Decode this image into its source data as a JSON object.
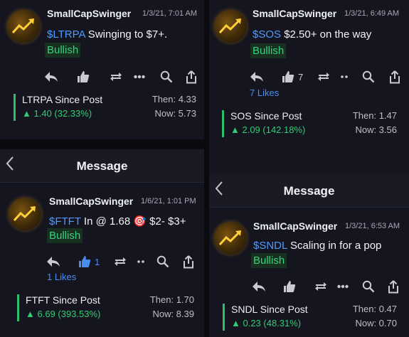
{
  "message_header": {
    "title": "Message",
    "back_icon": "chevron-left-icon"
  },
  "colors": {
    "cashtag": "#4d9bff",
    "bullish": "#37d27e",
    "gain": "#2fce74",
    "link": "#4a8df0"
  },
  "posts": [
    {
      "username": "SmallCapSwinger",
      "timestamp": "1/3/21, 7:01 AM",
      "cashtag": "$LTRPA",
      "text": " Swinging to $7+.",
      "sentiment": "Bullish",
      "like_count": "",
      "likes_label": "",
      "card": {
        "title": "LTRPA Since Post",
        "gain": "▲ 1.40 (32.33%)",
        "then": "Then: 4.33",
        "now": "Now: 5.73"
      }
    },
    {
      "username": "SmallCapSwinger",
      "timestamp": "1/3/21, 6:49 AM",
      "cashtag": "$SOS",
      "text": " $2.50+ on the way",
      "sentiment": "Bullish",
      "like_count": "7",
      "likes_label": "7 Likes",
      "card": {
        "title": "SOS Since Post",
        "gain": "▲ 2.09 (142.18%)",
        "then": "Then: 1.47",
        "now": "Now: 3.56"
      }
    },
    {
      "username": "SmallCapSwinger",
      "timestamp": "1/6/21, 1:01 PM",
      "cashtag": "$FTFT",
      "text": " In @ 1.68 🎯 $2- $3+",
      "sentiment": "Bullish",
      "like_count": "1",
      "likes_label": "1 Likes",
      "card": {
        "title": "FTFT Since Post",
        "gain": "▲ 6.69 (393.53%)",
        "then": "Then: 1.70",
        "now": "Now: 8.39"
      }
    },
    {
      "username": "SmallCapSwinger",
      "timestamp": "1/3/21, 6:53 AM",
      "cashtag": "$SNDL",
      "text": " Scaling in for a pop",
      "sentiment": "Bullish",
      "like_count": "",
      "likes_label": "",
      "card": {
        "title": "SNDL Since Post",
        "gain": "▲ 0.23 (48.31%)",
        "then": "Then: 0.47",
        "now": "Now: 0.70"
      }
    }
  ]
}
